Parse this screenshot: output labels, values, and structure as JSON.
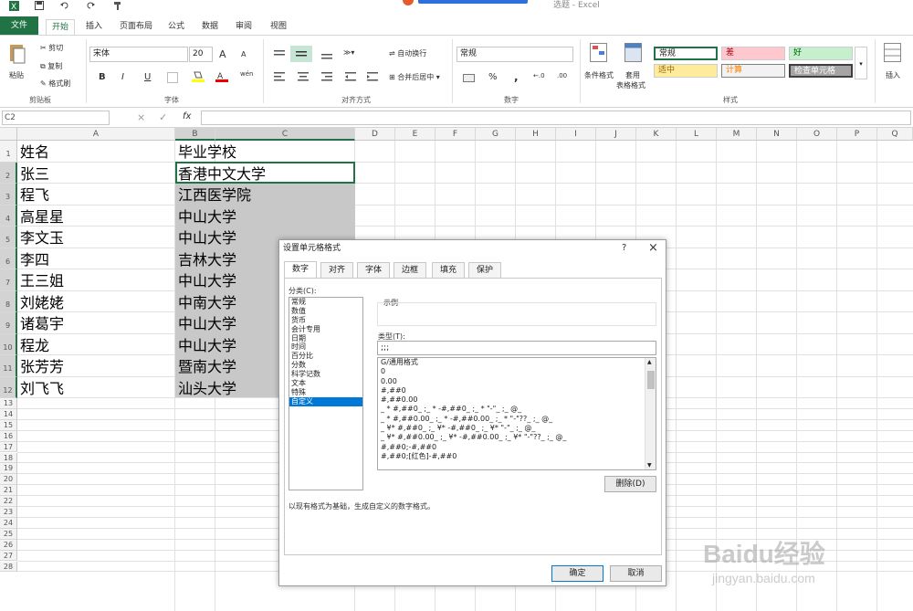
{
  "quickaccess": {
    "icons": [
      "excel-logo",
      "save",
      "undo",
      "redo",
      "brush"
    ]
  },
  "window": {
    "title": "选题 - Excel"
  },
  "ribbon_tabs": [
    "文件",
    "开始",
    "插入",
    "页面布局",
    "公式",
    "数据",
    "审阅",
    "视图"
  ],
  "clipboard": {
    "paste": "粘贴",
    "cut": "剪切",
    "copy": "复制",
    "format_painter": "格式刷",
    "label": "剪贴板"
  },
  "font": {
    "name": "宋体",
    "size": "20",
    "bold": "B",
    "italic": "I",
    "underline": "U",
    "label": "字体",
    "grow": "A",
    "shrink": "A",
    "wen": "wén"
  },
  "alignment": {
    "wrap": "自动换行",
    "merge": "合并后居中",
    "label": "对齐方式"
  },
  "number": {
    "format": "常规",
    "label": "数字",
    "percent": "%",
    "comma": ",",
    "inc": "←.0",
    "dec": ".00"
  },
  "styles": {
    "cond": "条件格式",
    "table": "套用",
    "table2": "表格格式",
    "label": "样式",
    "cells": [
      {
        "text": "常规",
        "bg": "#ffffff",
        "fg": "#000000"
      },
      {
        "text": "差",
        "bg": "#ffc7ce",
        "fg": "#9c0006"
      },
      {
        "text": "好",
        "bg": "#c6efce",
        "fg": "#006100"
      },
      {
        "text": "适中",
        "bg": "#ffeb9c",
        "fg": "#9c6500"
      },
      {
        "text": "计算",
        "bg": "#f2f2f2",
        "fg": "#fa7d00"
      },
      {
        "text": "检查单元格",
        "bg": "#a5a5a5",
        "fg": "#ffffff"
      }
    ]
  },
  "insert": {
    "label": "插入"
  },
  "formula": {
    "namebox": "C2",
    "cancel": "×",
    "enter": "✓",
    "fx": "fx"
  },
  "columns": [
    "A",
    "B",
    "C",
    "D",
    "E",
    "F",
    "G",
    "H",
    "I",
    "J",
    "K",
    "L",
    "M",
    "N",
    "O",
    "P",
    "Q"
  ],
  "rows": [
    "1",
    "2",
    "3",
    "4",
    "5",
    "6",
    "7",
    "8",
    "9",
    "10",
    "11",
    "12",
    "13",
    "14",
    "15",
    "16",
    "17",
    "18",
    "19",
    "20",
    "21",
    "22",
    "23",
    "24",
    "25",
    "26",
    "27",
    "28"
  ],
  "header": {
    "name": "姓名",
    "school": "毕业学校"
  },
  "people": [
    {
      "name": "张三",
      "school": "香港中文大学"
    },
    {
      "name": "程飞",
      "school": "江西医学院"
    },
    {
      "name": "高星星",
      "school": "中山大学"
    },
    {
      "name": "李文玉",
      "school": "中山大学"
    },
    {
      "name": "李四",
      "school": "吉林大学"
    },
    {
      "name": "王三姐",
      "school": "中山大学"
    },
    {
      "name": "刘姥姥",
      "school": "中南大学"
    },
    {
      "name": "诸葛宇",
      "school": "中山大学"
    },
    {
      "name": "程龙",
      "school": "中山大学"
    },
    {
      "name": "张芳芳",
      "school": "暨南大学"
    },
    {
      "name": "刘飞飞",
      "school": "汕头大学"
    }
  ],
  "dialog": {
    "title": "设置单元格格式",
    "help": "?",
    "close": "×",
    "tabs": [
      "数字",
      "对齐",
      "字体",
      "边框",
      "填充",
      "保护"
    ],
    "category_label": "分类(C):",
    "categories": [
      "常规",
      "数值",
      "货币",
      "会计专用",
      "日期",
      "时间",
      "百分比",
      "分数",
      "科学记数",
      "文本",
      "特殊",
      "自定义"
    ],
    "selected_category": "自定义",
    "sample_label": "示例",
    "type_label": "类型(T):",
    "type_value": ";;;",
    "formats": [
      "G/通用格式",
      "0",
      "0.00",
      "#,##0",
      "#,##0.00",
      "_ * #,##0_ ;_ * -#,##0_ ;_ * \"-\"_ ;_ @_",
      "_ * #,##0.00_ ;_ * -#,##0.00_ ;_ * \"-\"??_ ;_ @_",
      "_ ¥* #,##0_ ;_ ¥* -#,##0_ ;_ ¥* \"-\"_ ;_ @_",
      "_ ¥* #,##0.00_ ;_ ¥* -#,##0.00_ ;_ ¥* \"-\"??_ ;_ @_",
      "#,##0;-#,##0",
      "#,##0;[红色]-#,##0"
    ],
    "delete": "删除(D)",
    "description": "以现有格式为基础，生成自定义的数字格式。",
    "ok": "确定",
    "cancel": "取消"
  },
  "watermark": {
    "text1": "Baidu经验",
    "text2": "jingyan.baidu.com"
  }
}
